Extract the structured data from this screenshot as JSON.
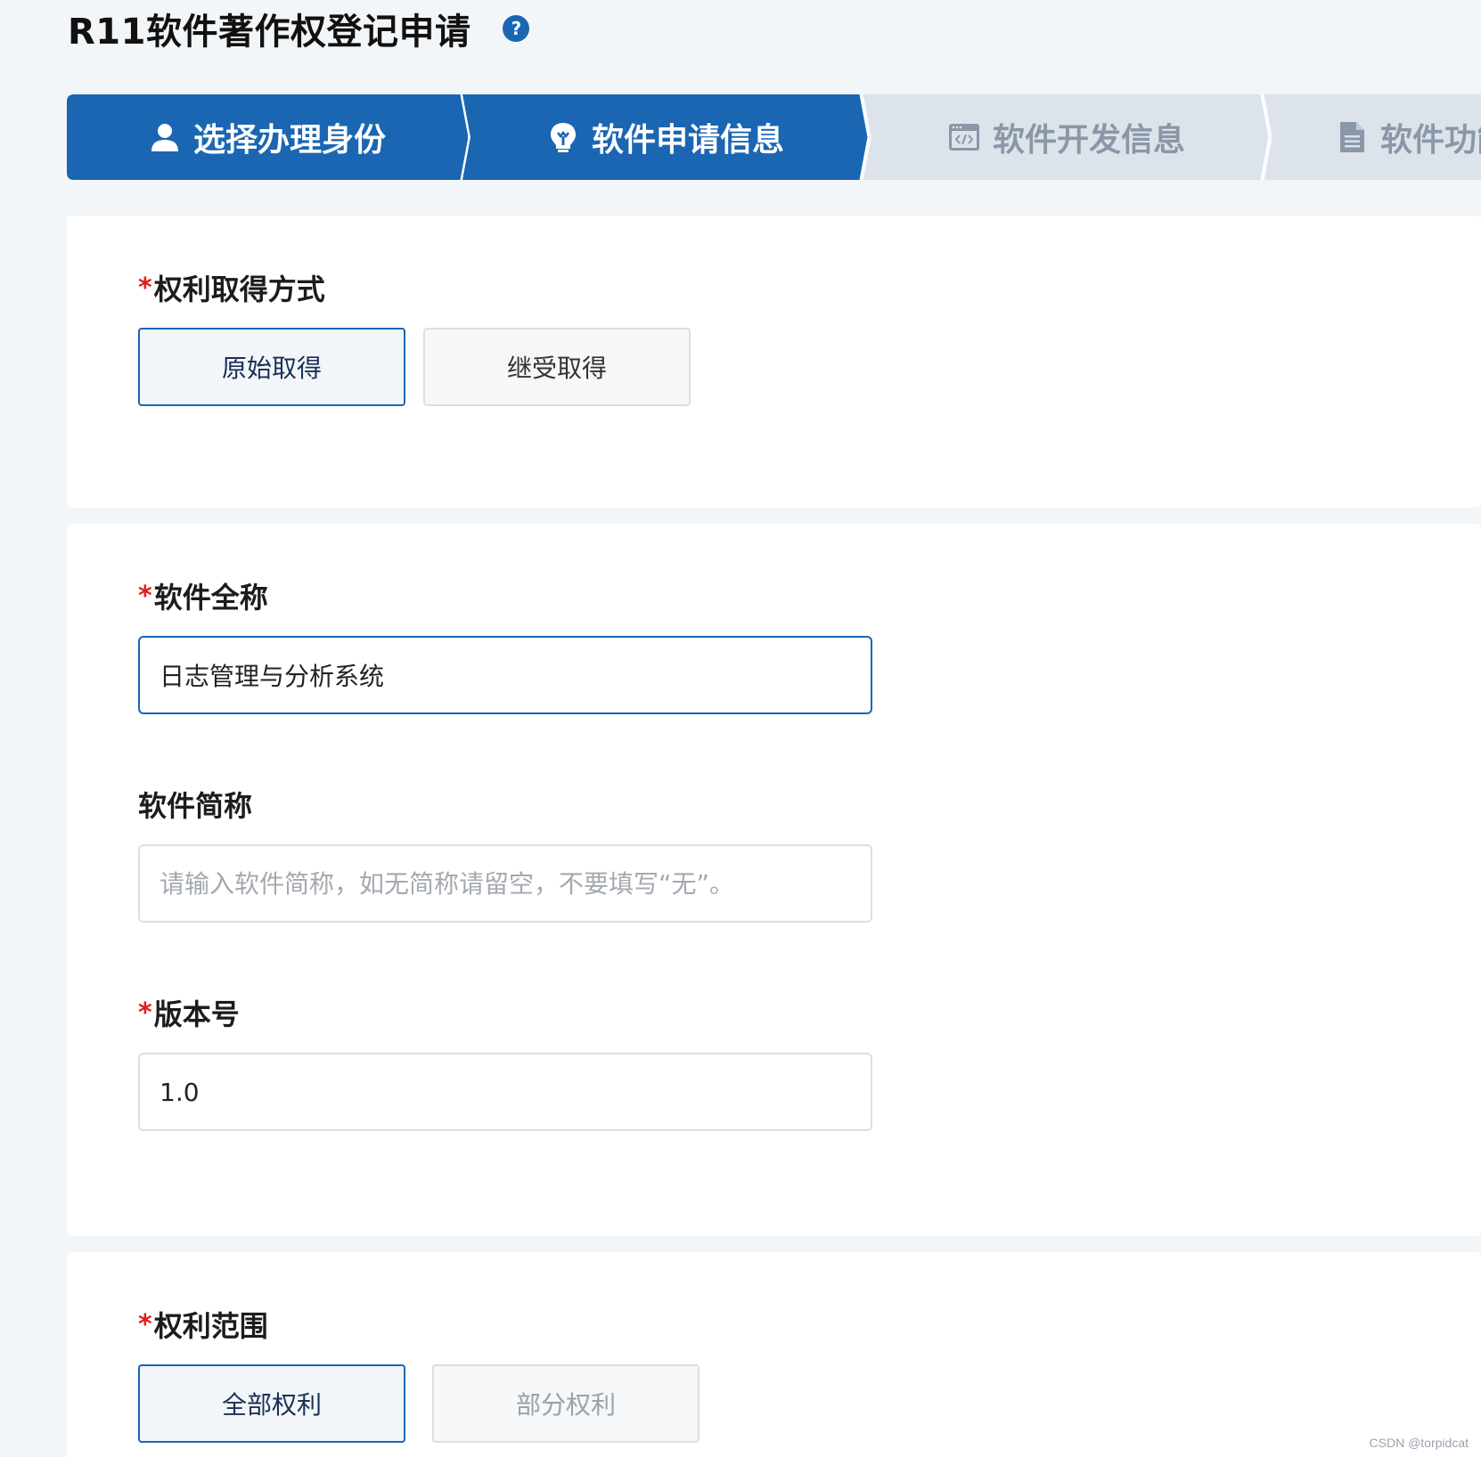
{
  "header": {
    "title": "R11软件著作权登记申请",
    "help_icon": "question-circle-icon"
  },
  "steps": [
    {
      "label": "选择办理身份",
      "icon": "user-icon",
      "state": "completed"
    },
    {
      "label": "软件申请信息",
      "icon": "lightbulb-icon",
      "state": "active"
    },
    {
      "label": "软件开发信息",
      "icon": "code-window-icon",
      "state": "pending"
    },
    {
      "label": "软件功能",
      "icon": "document-icon",
      "state": "pending"
    }
  ],
  "colors": {
    "accent": "#1a66b3",
    "required": "#e31b1b",
    "inactive_step_bg": "#dde3ea",
    "page_bg": "#f3f6f8"
  },
  "rights_acquisition": {
    "label": "权利取得方式",
    "required_mark": "*",
    "options": [
      {
        "label": "原始取得",
        "selected": true
      },
      {
        "label": "继受取得",
        "selected": false
      }
    ]
  },
  "software_full_name": {
    "label": "软件全称",
    "required_mark": "*",
    "value": "日志管理与分析系统"
  },
  "software_short_name": {
    "label": "软件简称",
    "value": "",
    "placeholder": "请输入软件简称，如无简称请留空，不要填写“无”。"
  },
  "version": {
    "label": "版本号",
    "required_mark": "*",
    "value": "1.0"
  },
  "rights_scope": {
    "label": "权利范围",
    "required_mark": "*",
    "options": [
      {
        "label": "全部权利",
        "selected": true
      },
      {
        "label": "部分权利",
        "selected": false
      }
    ]
  },
  "watermark": "CSDN @torpidcat"
}
